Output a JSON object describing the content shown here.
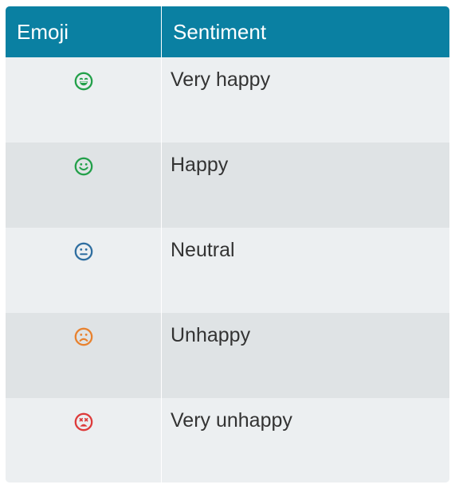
{
  "table": {
    "headers": {
      "emoji": "Emoji",
      "sentiment": "Sentiment"
    },
    "rows": [
      {
        "icon": "very-happy-face-icon",
        "color": "#23a04a",
        "label": "Very happy"
      },
      {
        "icon": "happy-face-icon",
        "color": "#23a04a",
        "label": "Happy"
      },
      {
        "icon": "neutral-face-icon",
        "color": "#2f6ea0",
        "label": "Neutral"
      },
      {
        "icon": "unhappy-face-icon",
        "color": "#e8822f",
        "label": "Unhappy"
      },
      {
        "icon": "very-unhappy-face-icon",
        "color": "#dd3b3b",
        "label": "Very unhappy"
      }
    ]
  },
  "colors": {
    "header_background": "#0a80a2",
    "row_light": "#eceff1",
    "row_dark": "#dfe3e5"
  }
}
